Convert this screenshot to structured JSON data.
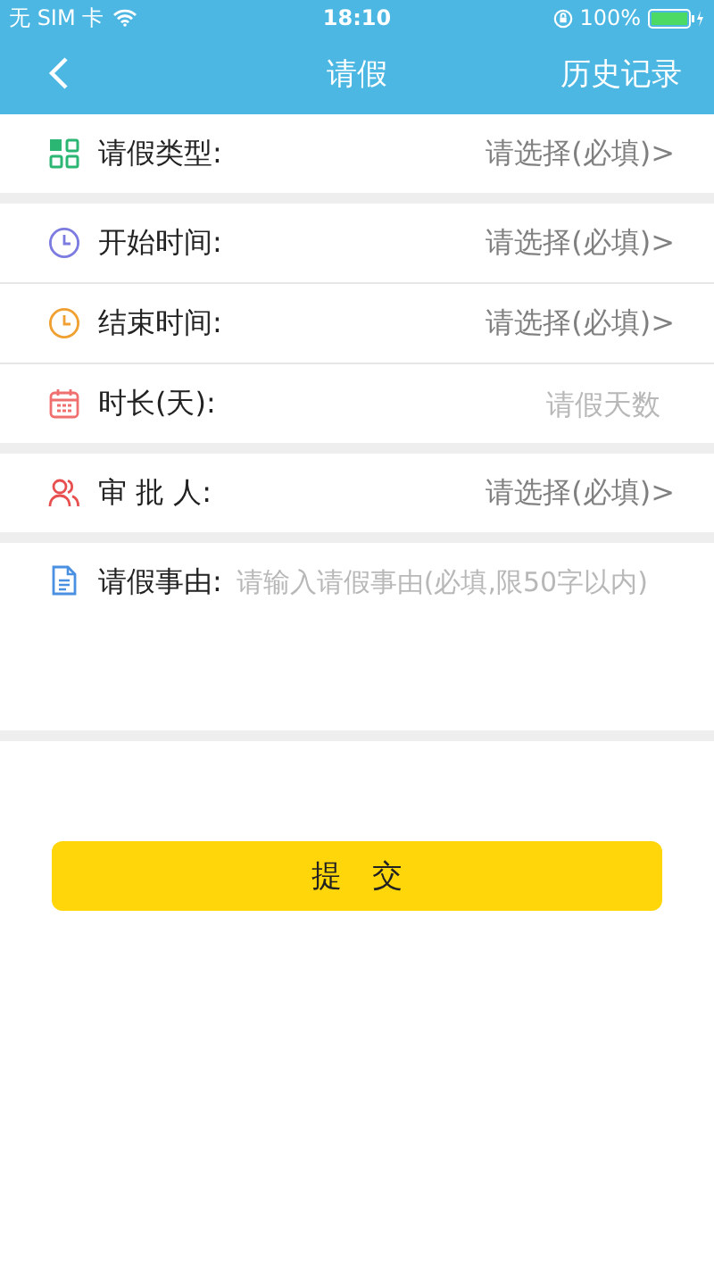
{
  "status_bar": {
    "carrier": "无 SIM 卡",
    "time": "18:10",
    "battery": "100%"
  },
  "nav": {
    "title": "请假",
    "action": "历史记录"
  },
  "sections": [
    {
      "rows": [
        {
          "kind": "select",
          "label": "请假类型:",
          "value": "请选择(必填)>"
        }
      ]
    },
    {
      "rows": [
        {
          "kind": "select",
          "label": "开始时间:",
          "value": "请选择(必填)>"
        },
        {
          "kind": "select",
          "label": "结束时间:",
          "value": "请选择(必填)>"
        },
        {
          "kind": "input",
          "label": "时长(天):",
          "placeholder": "请假天数"
        }
      ]
    },
    {
      "rows": [
        {
          "kind": "select",
          "label": "审 批 人:",
          "value": "请选择(必填)>"
        }
      ]
    },
    {
      "rows": [
        {
          "kind": "textarea",
          "label": "请假事由:",
          "placeholder": "请输入请假事由(必填,限50字以内)"
        }
      ]
    }
  ],
  "submit": "提　交"
}
